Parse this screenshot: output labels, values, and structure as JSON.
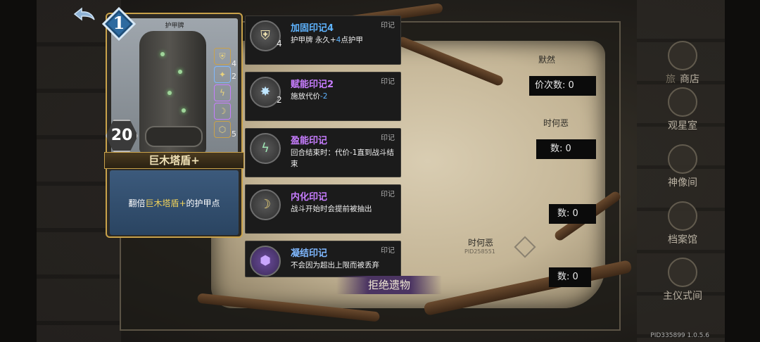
{
  "card": {
    "type": "护甲牌",
    "name": "巨木塔盾+",
    "cost": "20",
    "level": "1",
    "desc_prefix": "翻倍",
    "desc_highlight": "巨木塔盾+",
    "desc_suffix": "的护甲点",
    "mark_counts": [
      "4",
      "2",
      "5"
    ]
  },
  "marks": [
    {
      "name": "加固印记4",
      "tag": "印记",
      "count": "4",
      "desc_a": "护甲牌 永久+",
      "desc_num": "4",
      "desc_b": "点护甲",
      "color": "#5fb4ff",
      "icon": "fortify-mark-icon"
    },
    {
      "name": "赋能印记2",
      "tag": "印记",
      "count": "2",
      "desc_a": "施放代价",
      "desc_num": "-2",
      "desc_b": "",
      "color": "#c77dff",
      "icon": "empower-mark-icon"
    },
    {
      "name": "盈能印记",
      "tag": "印记",
      "count": "",
      "desc_a": "回合结束时：代价-1直到战斗结束",
      "desc_num": "",
      "desc_b": "",
      "color": "#c77dff",
      "icon": "surge-mark-icon"
    },
    {
      "name": "内化印记",
      "tag": "印记",
      "count": "",
      "desc_a": "战斗开始时会提前被抽出",
      "desc_num": "",
      "desc_b": "",
      "color": "#c77dff",
      "icon": "internalize-mark-icon"
    },
    {
      "name": "凝结印记",
      "tag": "印记",
      "count": "",
      "desc_a": "不会因为超出上限而被丢弃",
      "desc_num": "",
      "desc_b": "",
      "color": "#7fb8ff",
      "icon": "condense-mark-icon"
    }
  ],
  "records": {
    "name1": "默然",
    "row1": "价次数: 0",
    "name2": "时何恶",
    "row2": "数: 0",
    "row3": "数: 0",
    "row4": "数: 0",
    "stamp_name": "时何恶",
    "stamp_pid": "PID258551"
  },
  "sidebar": [
    {
      "label": "商店",
      "prefix": "旅"
    },
    {
      "label": "观星室"
    },
    {
      "label": "神像间"
    },
    {
      "label": "档案馆"
    },
    {
      "label": "主仪式间"
    }
  ],
  "refuse_label": "拒绝遗物",
  "version": "PID335899  1.0.5.6"
}
